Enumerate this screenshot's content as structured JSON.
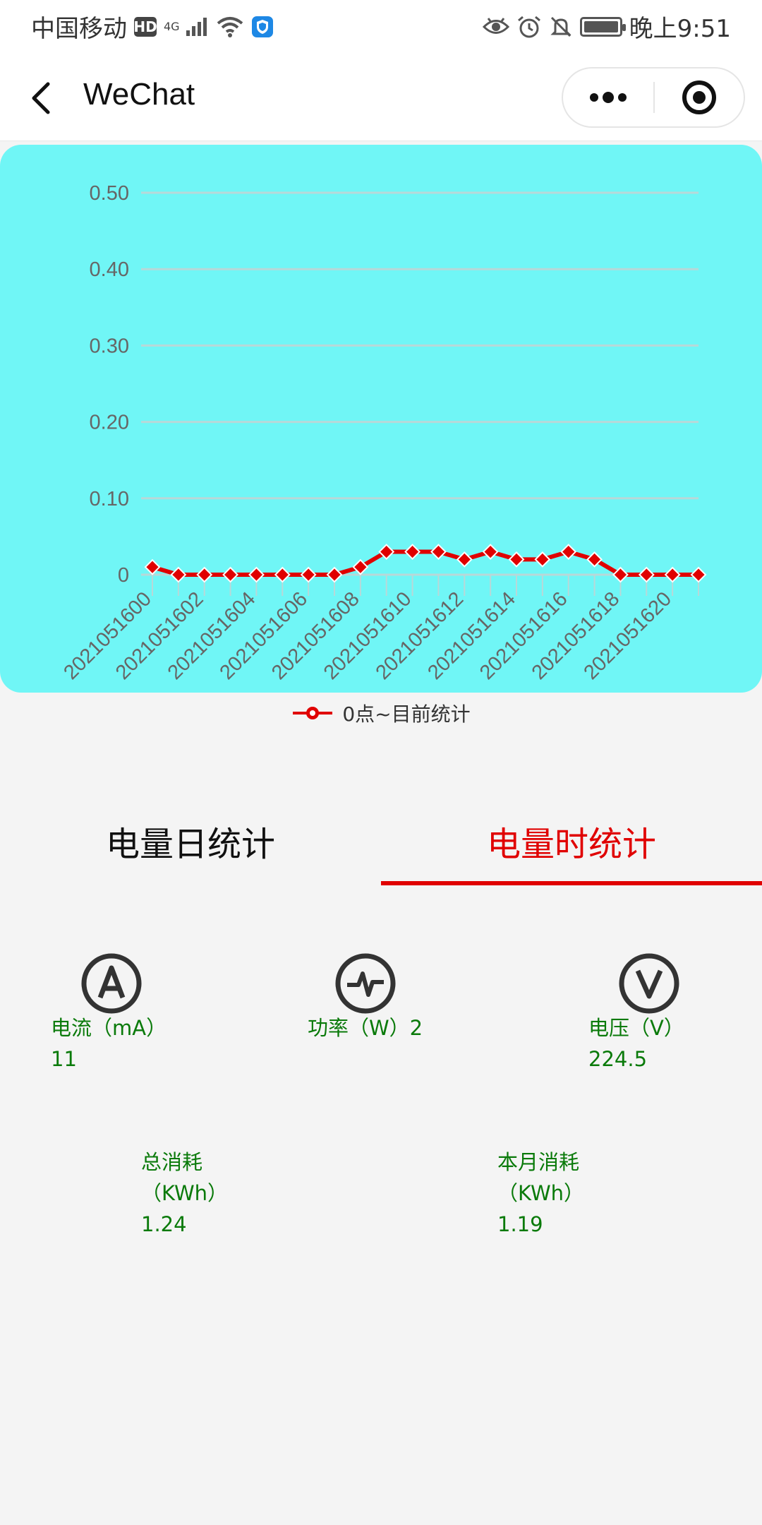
{
  "status_bar": {
    "carrier": "中国移动",
    "hd_badge": "HD",
    "network": "4G",
    "time": "晚上9:51",
    "icons": [
      "signal-icon",
      "wifi-icon",
      "shield-icon",
      "eye-icon",
      "alarm-icon",
      "bell-off-icon",
      "battery-icon"
    ]
  },
  "nav": {
    "title": "WeChat",
    "back_icon": "chevron-left-icon",
    "more_icon": "more-dots-icon",
    "close_icon": "target-circle-icon"
  },
  "chart_data": {
    "type": "line",
    "y_ticks": [
      "0.50",
      "0.40",
      "0.30",
      "0.20",
      "0.10",
      "0"
    ],
    "ylim": [
      0,
      0.5
    ],
    "x": [
      "2021051600",
      "2021051601",
      "2021051602",
      "2021051603",
      "2021051604",
      "2021051605",
      "2021051606",
      "2021051607",
      "2021051608",
      "2021051609",
      "2021051610",
      "2021051611",
      "2021051612",
      "2021051613",
      "2021051614",
      "2021051615",
      "2021051616",
      "2021051617",
      "2021051618",
      "2021051619",
      "2021051620",
      "2021051621"
    ],
    "x_tick_labels": [
      "2021051600",
      "2021051602",
      "2021051604",
      "2021051606",
      "2021051608",
      "2021051610",
      "2021051612",
      "2021051614",
      "2021051616",
      "2021051618",
      "2021051620"
    ],
    "series": [
      {
        "name": "0点~目前统计",
        "values": [
          0.01,
          0,
          0,
          0,
          0,
          0,
          0,
          0,
          0.01,
          0.03,
          0.03,
          0.03,
          0.02,
          0.03,
          0.02,
          0.02,
          0.03,
          0.02,
          0,
          0,
          0,
          0
        ]
      }
    ],
    "grid": true,
    "legend_position": "bottom-center",
    "colors": {
      "background": "#70f6f6",
      "line": "#e00000",
      "grid": "#b8d8d8",
      "axis_text": "#666666"
    }
  },
  "tabs": [
    {
      "label": "电量日统计",
      "active": false
    },
    {
      "label": "电量时统计",
      "active": true
    }
  ],
  "metrics": {
    "current": {
      "label": "电流（mA）",
      "value": "11",
      "icon": "ampere-icon"
    },
    "power": {
      "label": "功率（W）2",
      "icon": "pulse-icon"
    },
    "voltage": {
      "label": "电压（V）",
      "value": "224.5",
      "icon": "volt-icon"
    },
    "total": {
      "label_line1": "总消耗",
      "label_line2": "（KWh）",
      "value": "1.24"
    },
    "month": {
      "label_line1": "本月消耗",
      "label_line2": "（KWh）",
      "value": "1.19"
    }
  },
  "colors": {
    "accent": "#e00000",
    "metric_text": "#0a7a0a"
  }
}
